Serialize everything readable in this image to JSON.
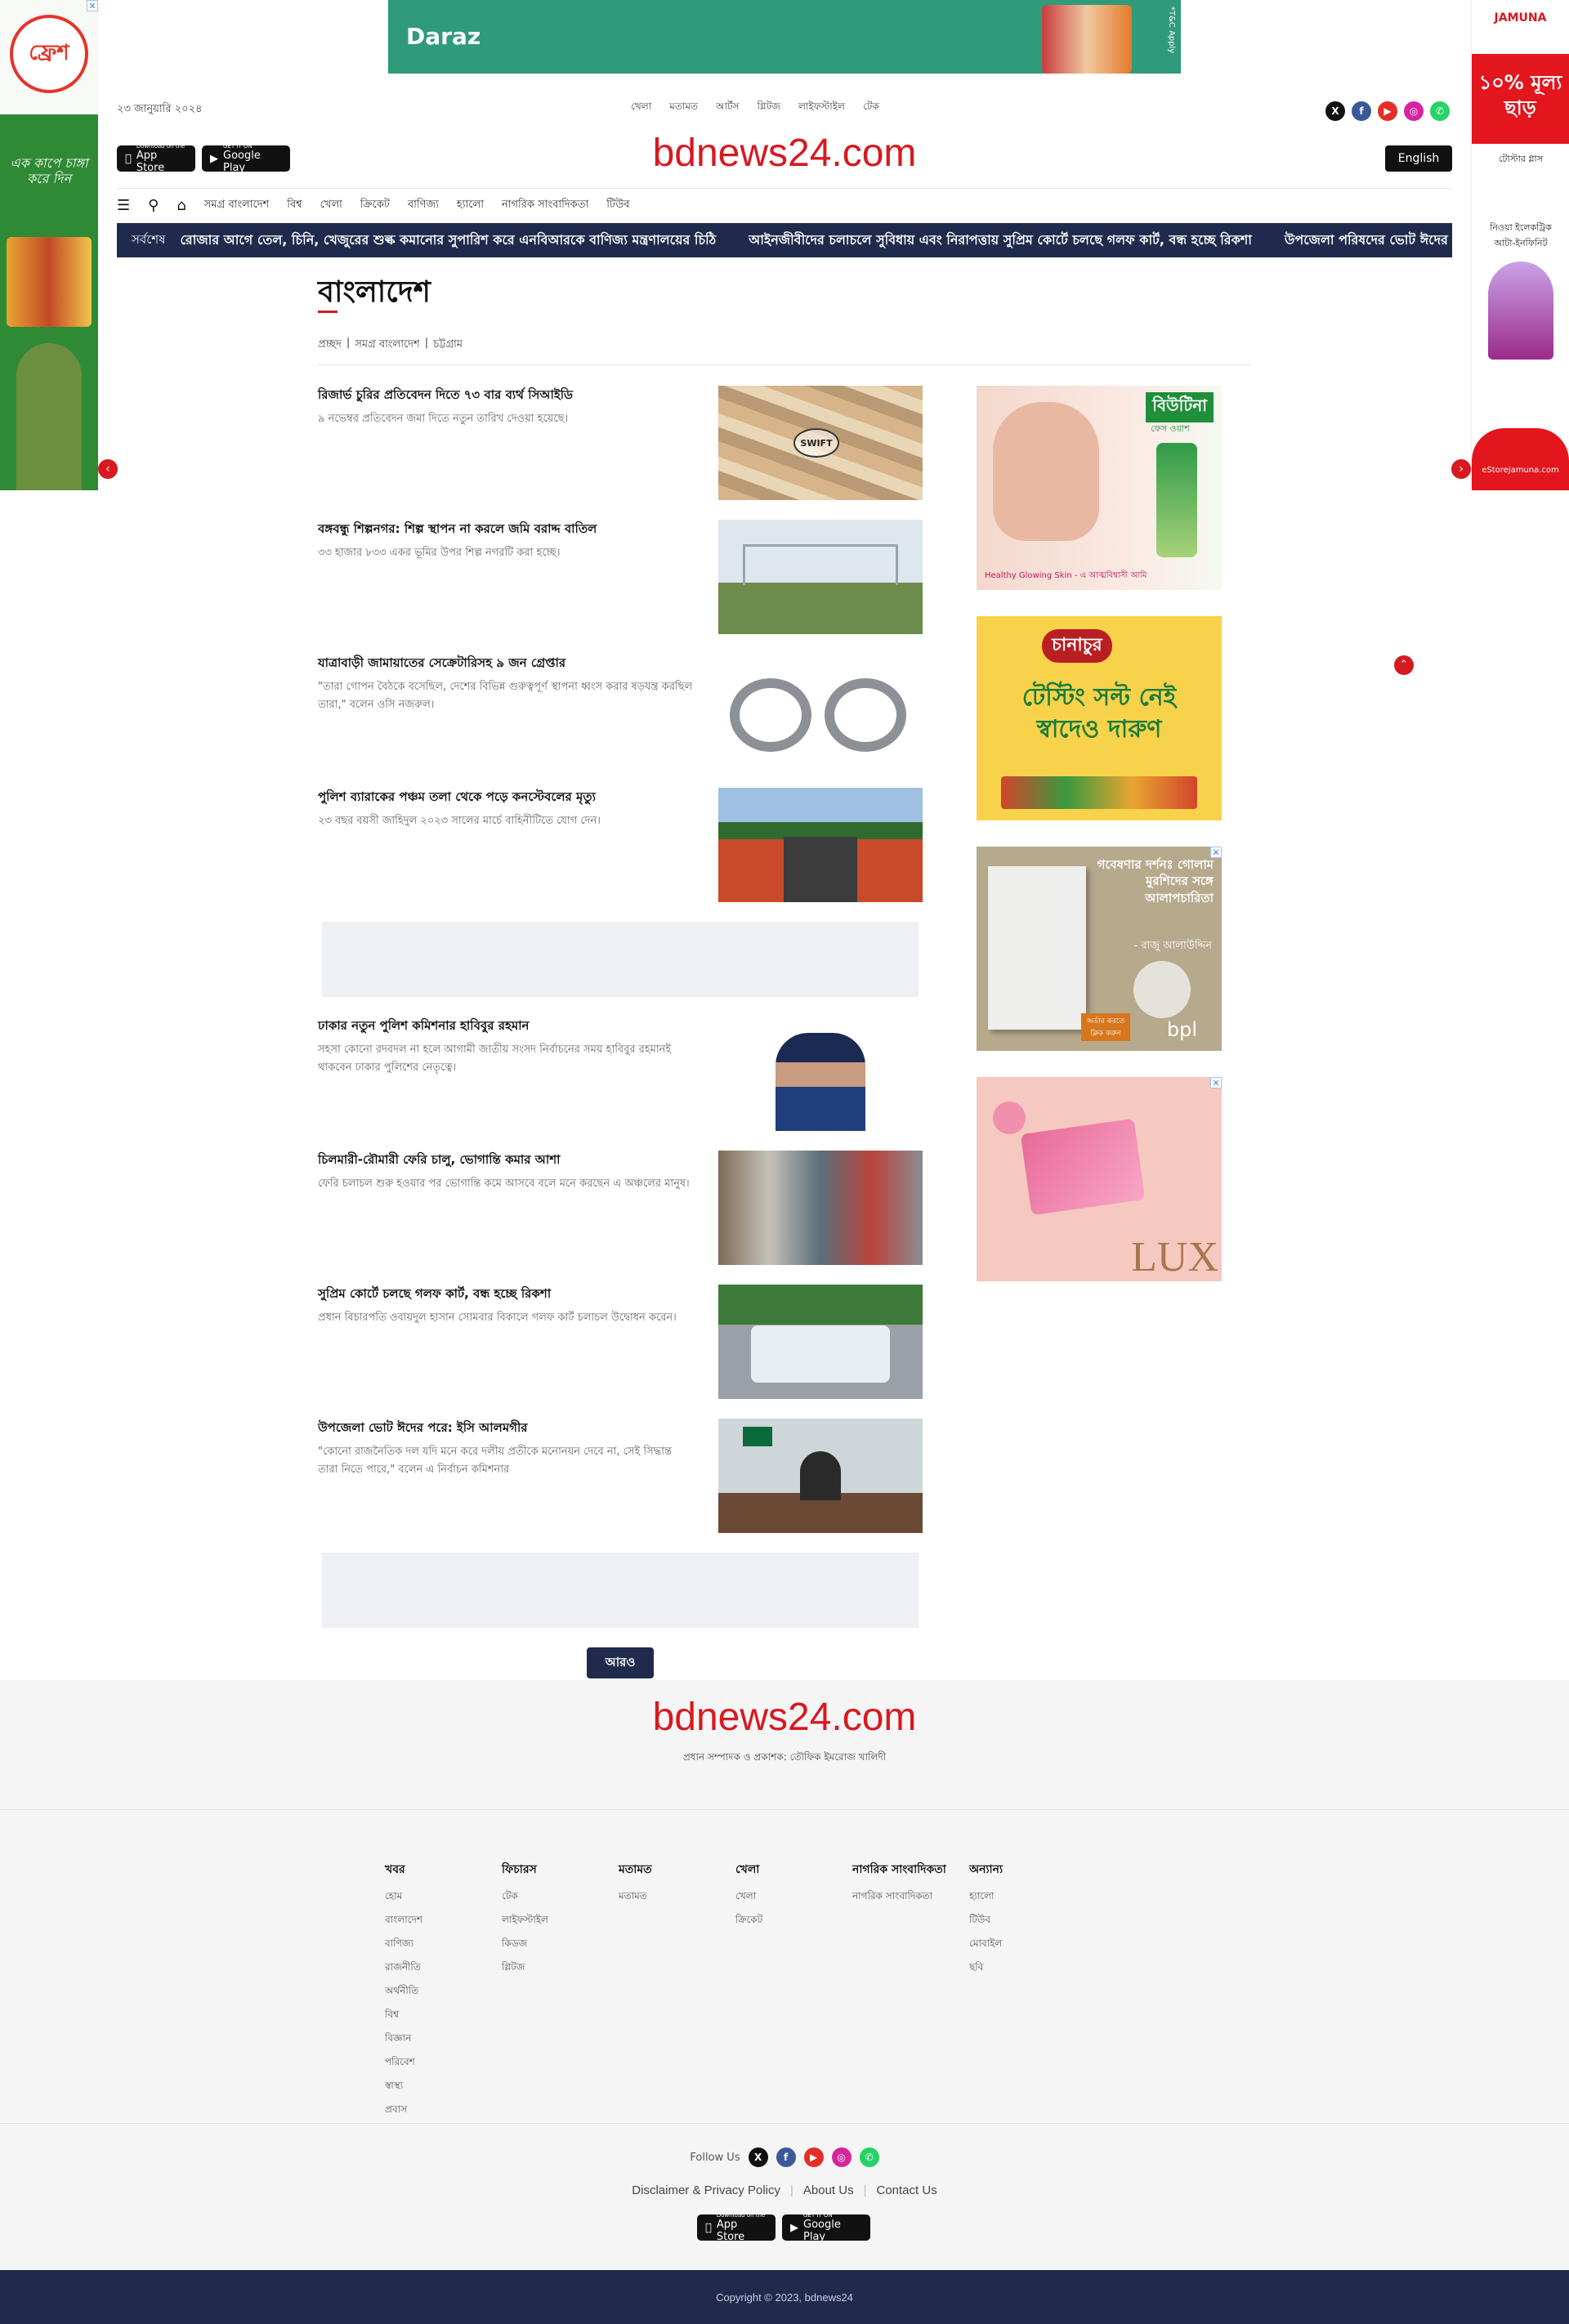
{
  "ads": {
    "top_banner_brand": "Daraz",
    "top_banner_note": "*T&C Apply",
    "left_skin_logo": "ফ্রেশ",
    "left_skin_slogan": "এক কাপে চাঙ্গা করে দিন",
    "right_skin_brand": "JAMUNA",
    "right_skin_offer": "১০% মূল্য ছাড়",
    "right_skin_item1": "টোস্টার গ্লাস",
    "right_skin_item2": "নিওয়া ইলেকট্রিক আটা-ইনফিনিট",
    "right_skin_site": "eStorejamuna.com",
    "sidebar": [
      {
        "brand": "বিউটিনা",
        "tagline": "ফেস ওয়াশ",
        "caption": "Healthy Glowing Skin - এ আত্মবিশ্বাসী আমি"
      },
      {
        "brand": "চানাচুর",
        "headline": "টেস্টিং সল্ট নেই স্বাদেও দারুণ"
      },
      {
        "headline": "গবেষণার দর্শনঃ গোলাম মুরশিদের সঙ্গে আলাপচারিতা",
        "author": "- রাজু আলাউদ্দিন",
        "cta": "অর্ডার করতে ক্লিক করুন",
        "publisher": "bpl"
      },
      {
        "brand": "LUX"
      }
    ]
  },
  "header": {
    "date": "২৩ জানুয়ারি ২০২৪",
    "top_nav": [
      "খেলা",
      "মতামত",
      "আর্টস",
      "গ্লিটজ",
      "লাইফস্টাইল",
      "টেক"
    ],
    "socials": [
      {
        "icon": "x-icon",
        "glyph": "X",
        "color": "#111111"
      },
      {
        "icon": "facebook-icon",
        "glyph": "f",
        "color": "#3b5998"
      },
      {
        "icon": "youtube-icon",
        "glyph": "▶",
        "color": "#e52d27"
      },
      {
        "icon": "instagram-icon",
        "glyph": "◎",
        "color": "#d6249f"
      },
      {
        "icon": "whatsapp-icon",
        "glyph": "✆",
        "color": "#25d366"
      }
    ],
    "app_store": {
      "small": "Download on the",
      "label": "App Store"
    },
    "google_play": {
      "small": "GET IT ON",
      "label": "Google Play"
    },
    "logo": "bdnews24.com",
    "language_button": "English"
  },
  "main_nav": [
    "সমগ্র বাংলাদেশ",
    "বিশ্ব",
    "খেলা",
    "ক্রিকেট",
    "বাণিজ্য",
    "হ্যালো",
    "নাগরিক সাংবাদিকতা",
    "টিউব"
  ],
  "ticker": {
    "label": "সর্বশেষ",
    "items": [
      "রোজার আগে তেল, চিনি, খেজুরের শুল্ক কমানোর সুপারিশ করে এনবিআরকে বাণিজ্য মন্ত্রণালয়ের চিঠি",
      "আইনজীবীদের চলাচলে সুবিধায় এবং নিরাপত্তায় সুপ্রিম কোর্টে চলছে গলফ কার্ট, বন্ধ হচ্ছে রিকশা",
      "উপজেলা পরিষদের ভোট ঈদের পরে: ইসি আলমগীর"
    ]
  },
  "page": {
    "title": "বাংলাদেশ",
    "breadcrumb": [
      "প্রচ্ছদ",
      "|",
      "সমগ্র বাংলাদেশ",
      "|",
      "চট্টগ্রাম"
    ]
  },
  "articles": [
    {
      "headline": "রিজার্ভ চুরির প্রতিবেদন দিতে ৭৩ বার ব্যর্থ সিআইডি",
      "summary": "৯ নভেম্বর প্রতিবেদন জমা দিতে নতুন তারিখ দেওয়া হয়েছে।",
      "thumb_label": "SWIFT"
    },
    {
      "headline": "বঙ্গবন্ধু শিল্পনগর: শিল্প স্থাপন না করলে জমি বরাদ্দ বাতিল",
      "summary": "৩৩ হাজার ৮৩৩ একর ভূমির উপর শিল্প নগরটি করা হচ্ছে।",
      "thumb_label": ""
    },
    {
      "headline": "যাত্রাবাড়ী জামায়াতের সেক্রেটারিসহ ৯ জন গ্রেপ্তার",
      "summary": "\"তারা গোপন বৈঠকে বসেছিল, দেশের বিভিন্ন গুরুত্বপূর্ণ স্থাপনা ধ্বংস করার ষড়যন্ত্র করছিল তারা,\" বলেন ওসি নজরুল।",
      "thumb_label": ""
    },
    {
      "headline": "পুলিশ ব্যারাকের পঞ্চম তলা থেকে পড়ে কনস্টেবলের মৃত্যু",
      "summary": "২৩ বছর বয়সী জাহিদুল ২০২৩ সালের মার্চে বাহিনীটিতে যোগ দেন।",
      "thumb_label": ""
    },
    {
      "headline": "ঢাকার নতুন পুলিশ কমিশনার হাবিবুর রহমান",
      "summary": "সহসা কোনো রদবদল না হলে আগামী জাতীয় সংসদ নির্বাচনের সময় হাবিবুর রহমানই থাকবেন ঢাকার পুলিশের নেতৃত্বে।",
      "thumb_label": ""
    },
    {
      "headline": "চিলমারী-রৌমারী ফেরি চালু, ভোগান্তি কমার আশা",
      "summary": "ফেরি চলাচল শুরু হওয়ার পর ভোগান্তি কমে আসবে বলে মনে করছেন এ অঞ্চলের মানুষ।",
      "thumb_label": ""
    },
    {
      "headline": "সুপ্রিম কোর্টে চলছে গলফ কার্ট, বন্ধ হচ্ছে রিকশা",
      "summary": "প্রধান বিচারপতি ওবায়দুল হাসান সোমবার বিকালে গলফ কার্ট চলাচল উদ্বোধন করেন।",
      "thumb_label": ""
    },
    {
      "headline": "উপজেলা ভোট ঈদের পরে: ইসি আলমগীর",
      "summary": "\"কোনো রাজনৈতিক দল যদি মনে করে দলীয় প্রতীকে মনোনয়ন দেবে না, সেই সিদ্ধান্ত তারা নিতে পারে,\" বলেন এ নির্বাচন কমিশনার",
      "thumb_label": ""
    }
  ],
  "more_button": "আরও",
  "footer": {
    "logo": "bdnews24.com",
    "editor": "প্রধান সম্পাদক ও প্রকাশক: তৌফিক ইমরোজ খালিদী",
    "columns": [
      {
        "title": "খবর",
        "links": [
          "হোম",
          "বাংলাদেশ",
          "বাণিজ্য",
          "রাজনীতি",
          "অর্থনীতি",
          "বিশ্ব",
          "বিজ্ঞান",
          "পরিবেশ",
          "স্বাস্থ্য",
          "প্রবাস"
        ]
      },
      {
        "title": "ফিচারস",
        "links": [
          "টেক",
          "লাইফস্টাইল",
          "কিডজ",
          "গ্লিটজ"
        ]
      },
      {
        "title": "মতামত",
        "links": [
          "মতামত"
        ]
      },
      {
        "title": "খেলা",
        "links": [
          "খেলা",
          "ক্রিকেট"
        ]
      },
      {
        "title": "নাগরিক সাংবাদিকতা",
        "links": [
          "নাগরিক সাংবাদিকতা"
        ]
      },
      {
        "title": "অন্যান্য",
        "links": [
          "হ্যালো",
          "টিউব",
          "মোবাইল",
          "ছবি"
        ]
      }
    ],
    "follow_label": "Follow Us",
    "policy_links": [
      "Disclaimer & Privacy Policy",
      "About Us",
      "Contact Us"
    ],
    "copyright": "Copyright © 2023, bdnews24"
  }
}
